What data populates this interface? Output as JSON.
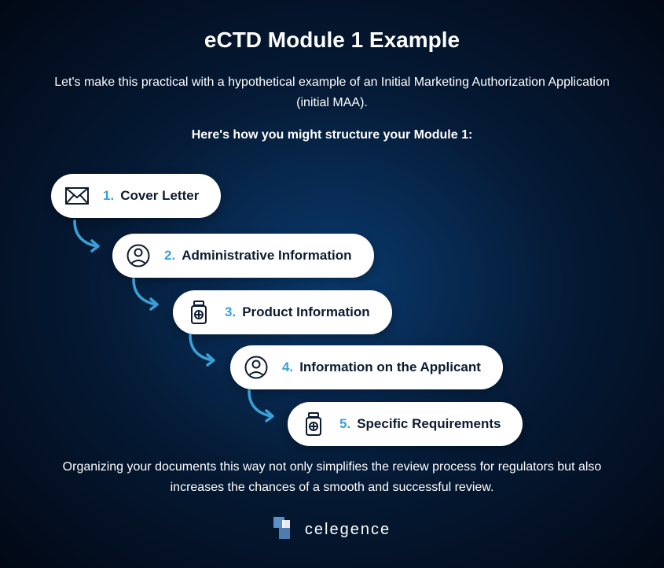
{
  "title": "eCTD Module 1 Example",
  "intro": "Let's make this practical with a hypothetical example of an Initial Marketing Authorization Application (initial MAA).",
  "subtitle": "Here's how you might structure your Module 1:",
  "steps": [
    {
      "num": "1.",
      "label": "Cover Letter",
      "icon": "envelope"
    },
    {
      "num": "2.",
      "label": "Administrative Information",
      "icon": "person"
    },
    {
      "num": "3.",
      "label": "Product Information",
      "icon": "jar"
    },
    {
      "num": "4.",
      "label": "Information on the Applicant",
      "icon": "person"
    },
    {
      "num": "5.",
      "label": "Specific Requirements",
      "icon": "jar"
    }
  ],
  "footer": "Organizing your documents this way not only simplifies the review process for regulators but also increases the chances of a smooth and successful review.",
  "brand": "celegence",
  "colors": {
    "accent": "#3a9fd6",
    "dark": "#0d1b30"
  }
}
